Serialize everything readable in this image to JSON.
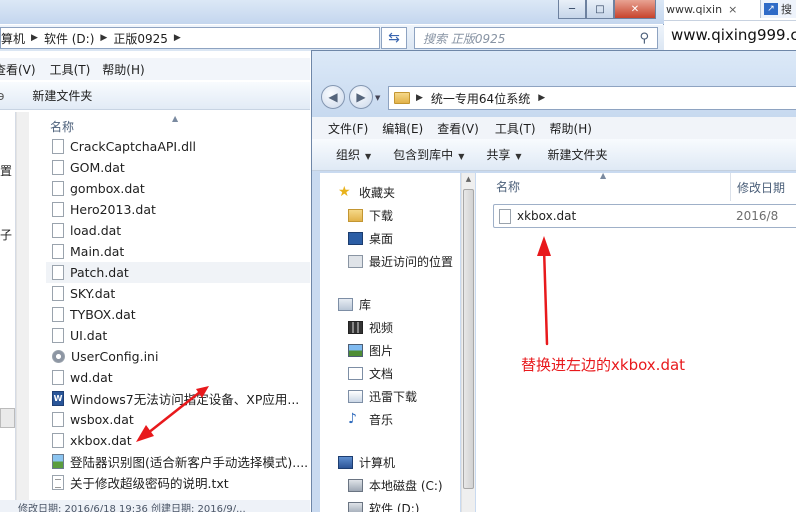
{
  "back_window": {
    "window_buttons": {
      "minimize": "─",
      "maximize": "□",
      "close": "✕"
    },
    "breadcrumb": [
      "算机",
      "软件 (D:)",
      "正版0925"
    ],
    "history_icon": "refresh-icon",
    "search_placeholder": "搜索 正版0925",
    "menu": [
      "查看(V)",
      "工具(T)",
      "帮助(H)"
    ],
    "cmd_new_folder": "新建文件夹",
    "left_cut_labels": [
      "置",
      "子"
    ],
    "column_name": "名称",
    "files": [
      {
        "name": "CrackCaptchaAPI.dll",
        "icon": "dll"
      },
      {
        "name": "GOM.dat",
        "icon": "file"
      },
      {
        "name": "gombox.dat",
        "icon": "file"
      },
      {
        "name": "Hero2013.dat",
        "icon": "file"
      },
      {
        "name": "load.dat",
        "icon": "file"
      },
      {
        "name": "Main.dat",
        "icon": "file"
      },
      {
        "name": "Patch.dat",
        "icon": "file",
        "selected": true
      },
      {
        "name": "SKY.dat",
        "icon": "file"
      },
      {
        "name": "TYBOX.dat",
        "icon": "file"
      },
      {
        "name": "UI.dat",
        "icon": "file"
      },
      {
        "name": "UserConfig.ini",
        "icon": "ini"
      },
      {
        "name": "wd.dat",
        "icon": "file"
      },
      {
        "name": "Windows7无法访问指定设备、XP应用...",
        "icon": "word"
      },
      {
        "name": "wsbox.dat",
        "icon": "file"
      },
      {
        "name": "xkbox.dat",
        "icon": "file"
      },
      {
        "name": "登陆器识别图(适合新客户手动选择模式)....",
        "icon": "image"
      },
      {
        "name": "关于修改超级密码的说明.txt",
        "icon": "txt"
      }
    ],
    "status": "修改日期: 2016/6/18 19:36      创建日期: 2016/9/..."
  },
  "browser": {
    "tab1": "www.qixin",
    "tab1_close": "×",
    "tab2": "搜",
    "url": "www.qixing999.c"
  },
  "front_window": {
    "back_icon": "back-arrow-icon",
    "forward_icon": "forward-arrow-icon",
    "path": "统一专用64位系统",
    "menu": [
      "文件(F)",
      "编辑(E)",
      "查看(V)",
      "工具(T)",
      "帮助(H)"
    ],
    "commands": [
      {
        "label": "组织",
        "dropdown": true
      },
      {
        "label": "包含到库中",
        "dropdown": true
      },
      {
        "label": "共享",
        "dropdown": true
      },
      {
        "label": "新建文件夹",
        "dropdown": false
      }
    ],
    "nav": {
      "favorites": "收藏夹",
      "downloads": "下载",
      "desktop": "桌面",
      "recent": "最近访问的位置",
      "libraries": "库",
      "videos": "视频",
      "pictures": "图片",
      "documents": "文档",
      "xunlei": "迅雷下载",
      "music": "音乐",
      "computer": "计算机",
      "local_c": "本地磁盘 (C:)",
      "local_d": "软件 (D:)"
    },
    "columns": {
      "name": "名称",
      "modified": "修改日期"
    },
    "file": {
      "name": "xkbox.dat",
      "date": "2016/8"
    }
  },
  "annotation": {
    "text": "替换进左边的xkbox.dat",
    "color": "#e8191c"
  }
}
